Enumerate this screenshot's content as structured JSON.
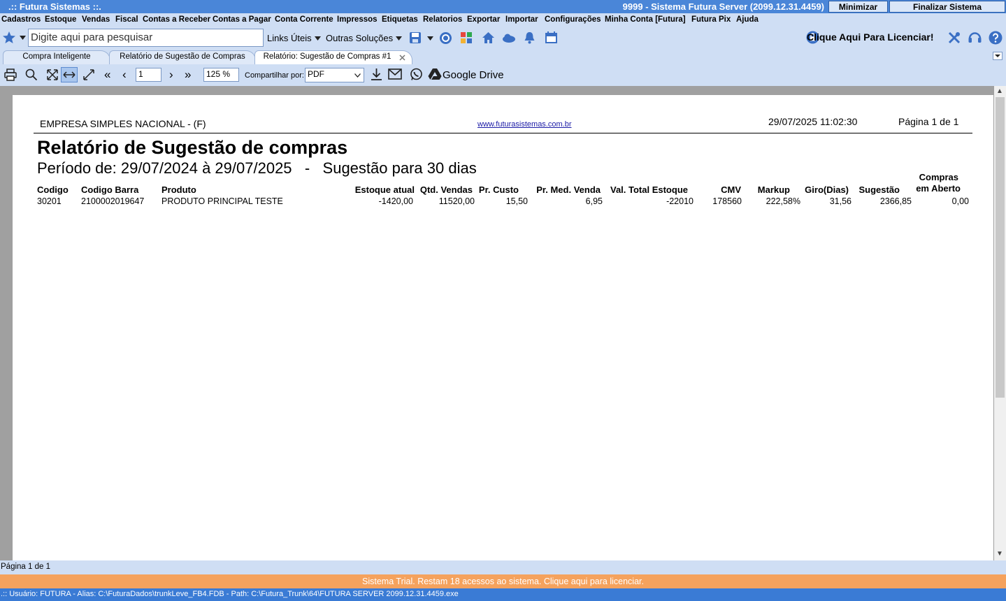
{
  "titlebar": {
    "app_title": ".:: Futura Sistemas ::.",
    "server_title": "9999 - Sistema Futura Server (2099.12.31.4459)",
    "minimize_label": "Minimizar",
    "close_label": "Finalizar Sistema"
  },
  "menu": [
    "Cadastros",
    "Estoque",
    "Vendas",
    "Fiscal",
    "Contas a Receber",
    "Contas a Pagar",
    "Conta Corrente",
    "Impressos",
    "Etiquetas",
    "Relatorios",
    "Exportar",
    "Importar",
    "Configurações",
    "Minha Conta [Futura]",
    "Futura Pix",
    "Ajuda"
  ],
  "toolbar": {
    "search_placeholder": "Digite aqui para pesquisar",
    "links_label": "Links Úteis",
    "solutions_label": "Outras Soluções",
    "license_label": "Clique Aqui Para Licenciar!"
  },
  "tabs": [
    {
      "label": "Compra Inteligente",
      "active": false
    },
    {
      "label": "Relatório de Sugestão de Compras",
      "active": false
    },
    {
      "label": "Relatório: Sugestão de Compras #1",
      "active": true,
      "closable": true
    }
  ],
  "report_toolbar": {
    "page_value": "1",
    "zoom_value": "125 %",
    "share_label": "Compartilhar por:",
    "share_value": "PDF",
    "drive_label": "Google Drive"
  },
  "report": {
    "company": "EMPRESA SIMPLES NACIONAL -  (F)",
    "website": "www.futurasistemas.com.br",
    "datetime": "29/07/2025 11:02:30",
    "page_info": "Página 1 de 1",
    "title": "Relatório de Sugestão de compras",
    "period": "Período de: 29/07/2024 à 29/07/2025   -   Sugestão para 30 dias",
    "columns": [
      "Codigo",
      "Codigo Barra",
      "Produto",
      "Estoque atual",
      "Qtd. Vendas",
      "Pr. Custo",
      "Pr. Med. Venda",
      "Val. Total Estoque",
      "CMV",
      "Markup",
      "Giro(Dias)",
      "Sugestão",
      "Compras",
      "em Aberto"
    ],
    "rows": [
      [
        "30201",
        "2100002019647",
        "PRODUTO PRINCIPAL TESTE",
        "-1420,00",
        "11520,00",
        "15,50",
        "6,95",
        "-22010",
        "178560",
        "222,58%",
        "31,56",
        "2366,85",
        "0,00"
      ]
    ]
  },
  "status": {
    "page_status": "Página 1 de 1",
    "trial": "Sistema Trial. Restam 18 acessos ao sistema. Clique aqui para licenciar.",
    "user_info": ".:: Usuário: FUTURA - Alias: C:\\FuturaDados\\trunkLeve_FB4.FDB - Path: C:\\Futura_Trunk\\64\\FUTURA SERVER 2099.12.31.4459.exe"
  },
  "colors": {
    "accent": "#4a86d8",
    "toolbar": "#cfdef4",
    "trial": "#f5a25d",
    "viewer_bg": "#a0a0a0"
  }
}
